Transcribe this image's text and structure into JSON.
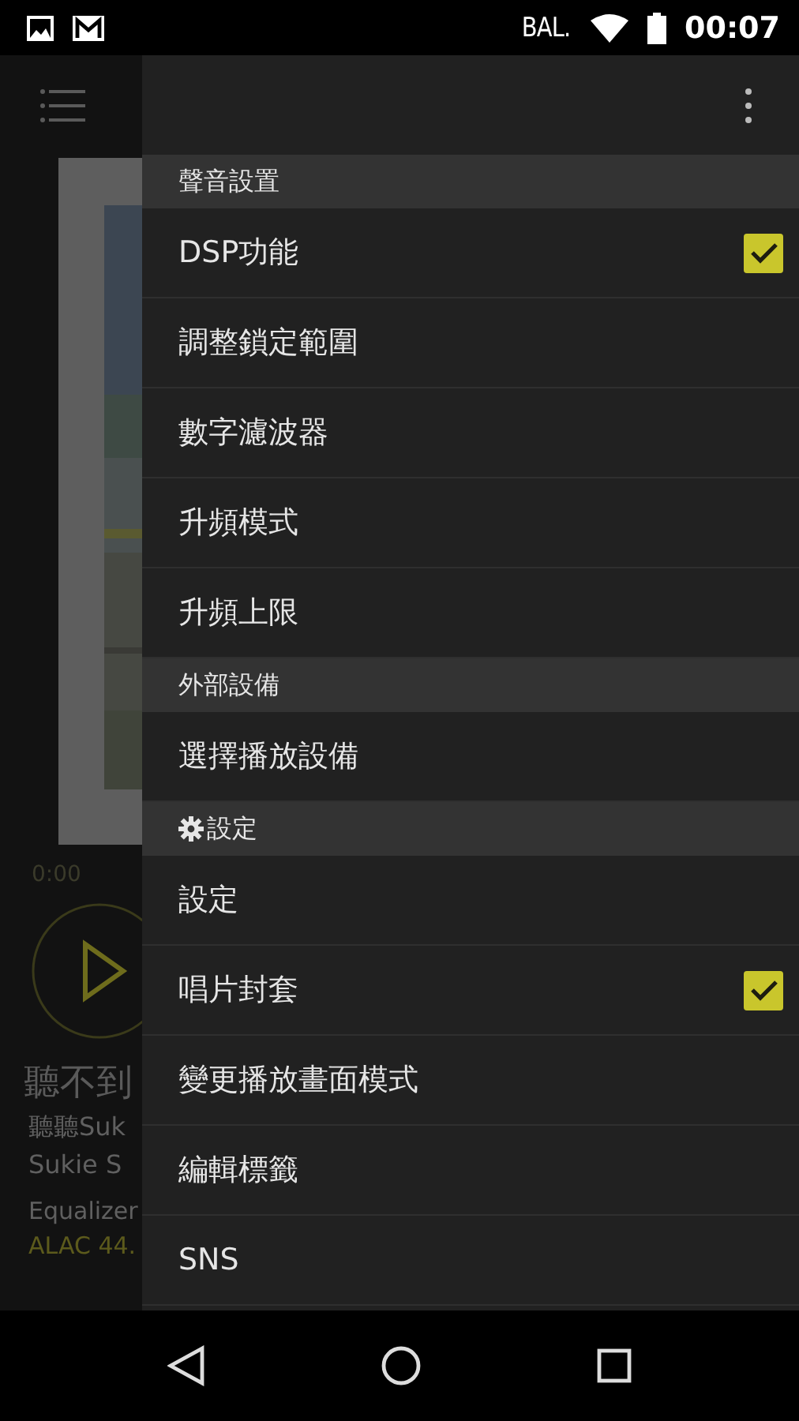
{
  "status_bar": {
    "carrier": "BAL.",
    "time": "00:07"
  },
  "player": {
    "elapsed": "0:00",
    "title": "聽不到",
    "album": "聽聽Suk",
    "artist": "Sukie S",
    "effect": "Equalizer",
    "format": "ALAC 44."
  },
  "menu": {
    "sections": [
      {
        "title": "聲音設置",
        "kind": "plain",
        "items": [
          {
            "label": "DSP功能",
            "kind": "checkbox",
            "checked": true
          },
          {
            "label": "調整鎖定範圍",
            "kind": "plain"
          },
          {
            "label": "數字濾波器",
            "kind": "plain"
          },
          {
            "label": "升頻模式",
            "kind": "plain"
          },
          {
            "label": "升頻上限",
            "kind": "plain"
          }
        ]
      },
      {
        "title": "外部設備",
        "kind": "plain",
        "items": [
          {
            "label": "選擇播放設備",
            "kind": "plain"
          }
        ]
      },
      {
        "title": "設定",
        "kind": "gear",
        "items": [
          {
            "label": "設定",
            "kind": "plain"
          },
          {
            "label": "唱片封套",
            "kind": "checkbox",
            "checked": true
          },
          {
            "label": "變更播放畫面模式",
            "kind": "plain"
          },
          {
            "label": "編輯標籤",
            "kind": "plain"
          },
          {
            "label": "SNS",
            "kind": "plain"
          }
        ]
      }
    ]
  }
}
